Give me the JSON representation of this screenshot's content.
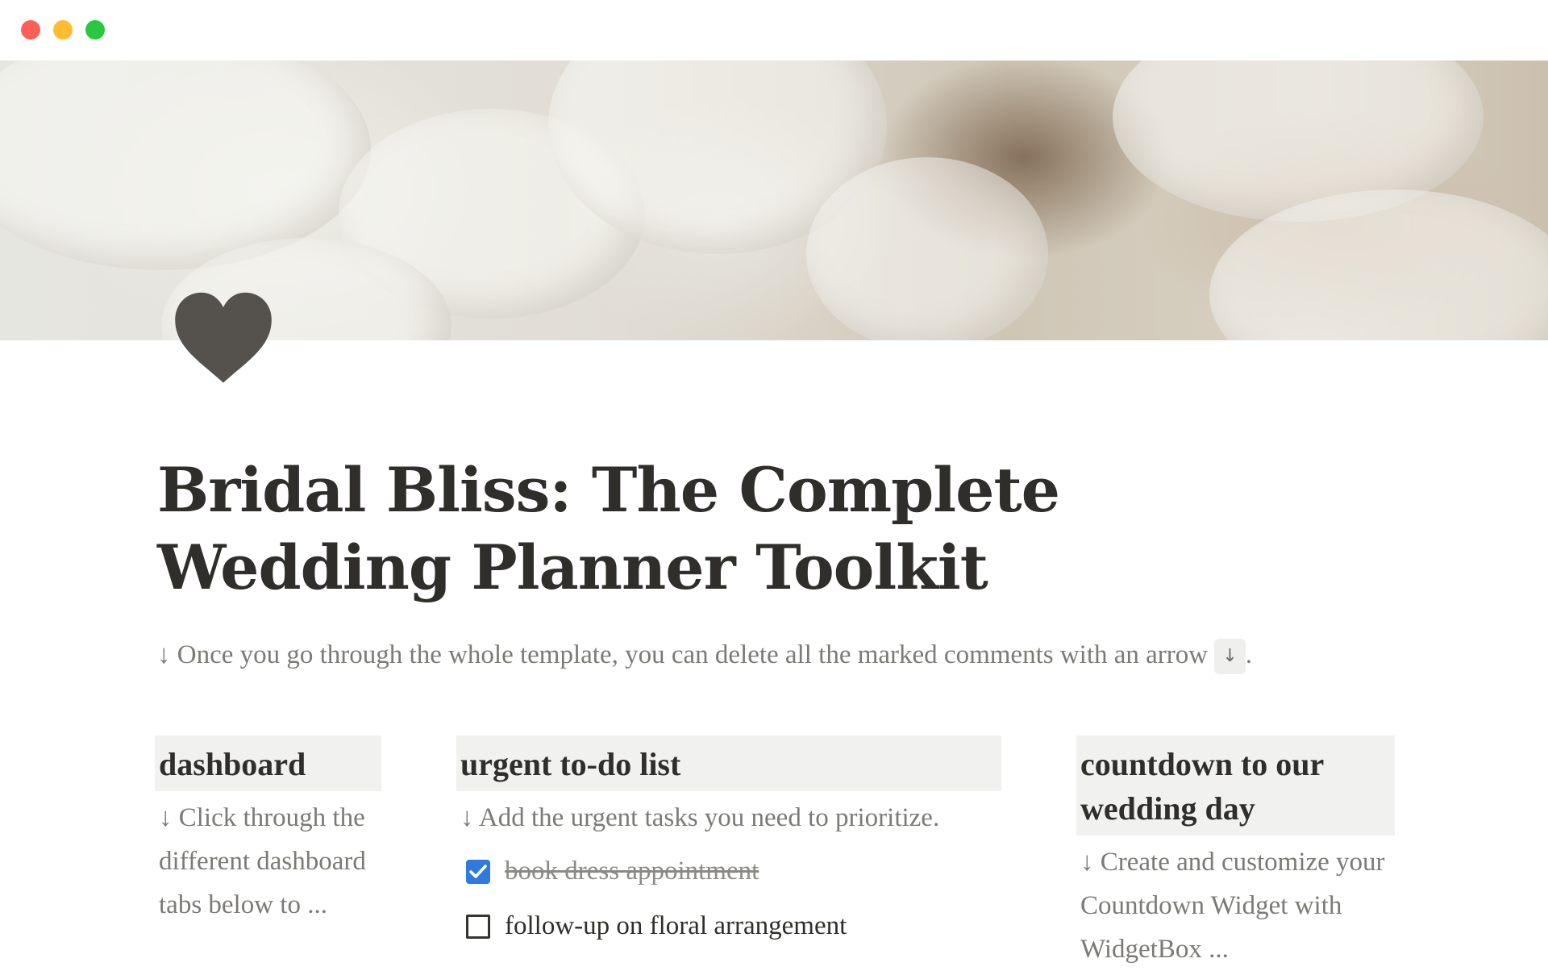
{
  "window": {
    "controls": [
      "close",
      "minimize",
      "maximize"
    ]
  },
  "cover": {
    "description_icon": "cover-image"
  },
  "page": {
    "icon": "heart-icon",
    "title": "Bridal Bliss: The Complete Wedding Planner Toolkit",
    "intro_text": "↓ Once you go through the whole template, you can delete all the marked comments with an arrow ",
    "intro_kbd": "↓",
    "intro_end": "."
  },
  "columns": {
    "dashboard": {
      "header": "dashboard",
      "text": "↓ Click through the different dashboard tabs below to ..."
    },
    "urgent": {
      "header": "urgent to-do list",
      "text": "↓ Add the urgent tasks you need to prioritize.",
      "todos": [
        {
          "label": "book dress appointment",
          "checked": true
        },
        {
          "label": "follow-up on floral arrangement",
          "checked": false
        }
      ]
    },
    "countdown": {
      "header": "countdown to our wedding day",
      "text": "↓ Create and customize your Countdown Widget with WidgetBox ..."
    }
  },
  "colors": {
    "checkbox_checked": "#2f7ae0",
    "header_bg": "#f1f1ef",
    "muted_text": "#7b7a76",
    "title_text": "#2f2e2a"
  }
}
